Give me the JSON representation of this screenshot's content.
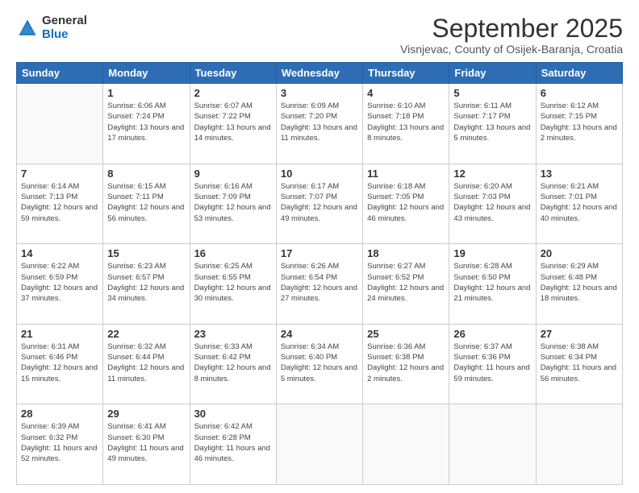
{
  "logo": {
    "general": "General",
    "blue": "Blue"
  },
  "header": {
    "month": "September 2025",
    "location": "Visnjevac, County of Osijek-Baranja, Croatia"
  },
  "weekdays": [
    "Sunday",
    "Monday",
    "Tuesday",
    "Wednesday",
    "Thursday",
    "Friday",
    "Saturday"
  ],
  "weeks": [
    [
      {
        "day": "",
        "sunrise": "",
        "sunset": "",
        "daylight": ""
      },
      {
        "day": "1",
        "sunrise": "Sunrise: 6:06 AM",
        "sunset": "Sunset: 7:24 PM",
        "daylight": "Daylight: 13 hours and 17 minutes."
      },
      {
        "day": "2",
        "sunrise": "Sunrise: 6:07 AM",
        "sunset": "Sunset: 7:22 PM",
        "daylight": "Daylight: 13 hours and 14 minutes."
      },
      {
        "day": "3",
        "sunrise": "Sunrise: 6:09 AM",
        "sunset": "Sunset: 7:20 PM",
        "daylight": "Daylight: 13 hours and 11 minutes."
      },
      {
        "day": "4",
        "sunrise": "Sunrise: 6:10 AM",
        "sunset": "Sunset: 7:18 PM",
        "daylight": "Daylight: 13 hours and 8 minutes."
      },
      {
        "day": "5",
        "sunrise": "Sunrise: 6:11 AM",
        "sunset": "Sunset: 7:17 PM",
        "daylight": "Daylight: 13 hours and 5 minutes."
      },
      {
        "day": "6",
        "sunrise": "Sunrise: 6:12 AM",
        "sunset": "Sunset: 7:15 PM",
        "daylight": "Daylight: 13 hours and 2 minutes."
      }
    ],
    [
      {
        "day": "7",
        "sunrise": "Sunrise: 6:14 AM",
        "sunset": "Sunset: 7:13 PM",
        "daylight": "Daylight: 12 hours and 59 minutes."
      },
      {
        "day": "8",
        "sunrise": "Sunrise: 6:15 AM",
        "sunset": "Sunset: 7:11 PM",
        "daylight": "Daylight: 12 hours and 56 minutes."
      },
      {
        "day": "9",
        "sunrise": "Sunrise: 6:16 AM",
        "sunset": "Sunset: 7:09 PM",
        "daylight": "Daylight: 12 hours and 53 minutes."
      },
      {
        "day": "10",
        "sunrise": "Sunrise: 6:17 AM",
        "sunset": "Sunset: 7:07 PM",
        "daylight": "Daylight: 12 hours and 49 minutes."
      },
      {
        "day": "11",
        "sunrise": "Sunrise: 6:18 AM",
        "sunset": "Sunset: 7:05 PM",
        "daylight": "Daylight: 12 hours and 46 minutes."
      },
      {
        "day": "12",
        "sunrise": "Sunrise: 6:20 AM",
        "sunset": "Sunset: 7:03 PM",
        "daylight": "Daylight: 12 hours and 43 minutes."
      },
      {
        "day": "13",
        "sunrise": "Sunrise: 6:21 AM",
        "sunset": "Sunset: 7:01 PM",
        "daylight": "Daylight: 12 hours and 40 minutes."
      }
    ],
    [
      {
        "day": "14",
        "sunrise": "Sunrise: 6:22 AM",
        "sunset": "Sunset: 6:59 PM",
        "daylight": "Daylight: 12 hours and 37 minutes."
      },
      {
        "day": "15",
        "sunrise": "Sunrise: 6:23 AM",
        "sunset": "Sunset: 6:57 PM",
        "daylight": "Daylight: 12 hours and 34 minutes."
      },
      {
        "day": "16",
        "sunrise": "Sunrise: 6:25 AM",
        "sunset": "Sunset: 6:55 PM",
        "daylight": "Daylight: 12 hours and 30 minutes."
      },
      {
        "day": "17",
        "sunrise": "Sunrise: 6:26 AM",
        "sunset": "Sunset: 6:54 PM",
        "daylight": "Daylight: 12 hours and 27 minutes."
      },
      {
        "day": "18",
        "sunrise": "Sunrise: 6:27 AM",
        "sunset": "Sunset: 6:52 PM",
        "daylight": "Daylight: 12 hours and 24 minutes."
      },
      {
        "day": "19",
        "sunrise": "Sunrise: 6:28 AM",
        "sunset": "Sunset: 6:50 PM",
        "daylight": "Daylight: 12 hours and 21 minutes."
      },
      {
        "day": "20",
        "sunrise": "Sunrise: 6:29 AM",
        "sunset": "Sunset: 6:48 PM",
        "daylight": "Daylight: 12 hours and 18 minutes."
      }
    ],
    [
      {
        "day": "21",
        "sunrise": "Sunrise: 6:31 AM",
        "sunset": "Sunset: 6:46 PM",
        "daylight": "Daylight: 12 hours and 15 minutes."
      },
      {
        "day": "22",
        "sunrise": "Sunrise: 6:32 AM",
        "sunset": "Sunset: 6:44 PM",
        "daylight": "Daylight: 12 hours and 11 minutes."
      },
      {
        "day": "23",
        "sunrise": "Sunrise: 6:33 AM",
        "sunset": "Sunset: 6:42 PM",
        "daylight": "Daylight: 12 hours and 8 minutes."
      },
      {
        "day": "24",
        "sunrise": "Sunrise: 6:34 AM",
        "sunset": "Sunset: 6:40 PM",
        "daylight": "Daylight: 12 hours and 5 minutes."
      },
      {
        "day": "25",
        "sunrise": "Sunrise: 6:36 AM",
        "sunset": "Sunset: 6:38 PM",
        "daylight": "Daylight: 12 hours and 2 minutes."
      },
      {
        "day": "26",
        "sunrise": "Sunrise: 6:37 AM",
        "sunset": "Sunset: 6:36 PM",
        "daylight": "Daylight: 11 hours and 59 minutes."
      },
      {
        "day": "27",
        "sunrise": "Sunrise: 6:38 AM",
        "sunset": "Sunset: 6:34 PM",
        "daylight": "Daylight: 11 hours and 56 minutes."
      }
    ],
    [
      {
        "day": "28",
        "sunrise": "Sunrise: 6:39 AM",
        "sunset": "Sunset: 6:32 PM",
        "daylight": "Daylight: 11 hours and 52 minutes."
      },
      {
        "day": "29",
        "sunrise": "Sunrise: 6:41 AM",
        "sunset": "Sunset: 6:30 PM",
        "daylight": "Daylight: 11 hours and 49 minutes."
      },
      {
        "day": "30",
        "sunrise": "Sunrise: 6:42 AM",
        "sunset": "Sunset: 6:28 PM",
        "daylight": "Daylight: 11 hours and 46 minutes."
      },
      {
        "day": "",
        "sunrise": "",
        "sunset": "",
        "daylight": ""
      },
      {
        "day": "",
        "sunrise": "",
        "sunset": "",
        "daylight": ""
      },
      {
        "day": "",
        "sunrise": "",
        "sunset": "",
        "daylight": ""
      },
      {
        "day": "",
        "sunrise": "",
        "sunset": "",
        "daylight": ""
      }
    ]
  ]
}
